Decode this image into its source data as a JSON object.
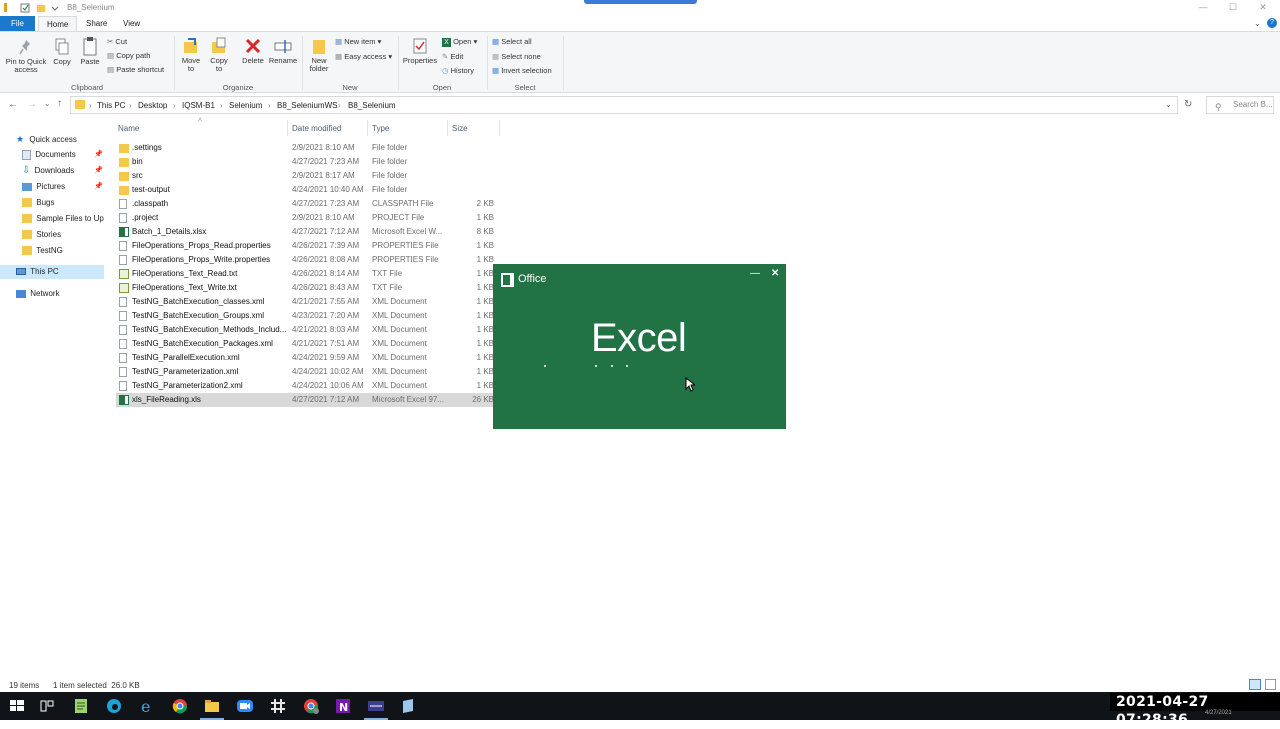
{
  "window": {
    "title": "B8_Selenium",
    "controls": {
      "minimize": "—",
      "maximize": "☐",
      "close": "✕"
    }
  },
  "tabs": [
    "File",
    "Home",
    "Share",
    "View"
  ],
  "ribbon": {
    "clipboard": {
      "pin": "Pin to Quick access",
      "copy": "Copy",
      "paste": "Paste",
      "cut": "Cut",
      "copy_path": "Copy path",
      "paste_shortcut": "Paste shortcut",
      "label": "Clipboard"
    },
    "organize": {
      "move_to": "Move to",
      "copy_to": "Copy to",
      "delete": "Delete",
      "rename": "Rename",
      "label": "Organize"
    },
    "new": {
      "new_folder": "New folder",
      "new_item": "New item",
      "easy_access": "Easy access",
      "label": "New"
    },
    "open": {
      "properties": "Properties",
      "open": "Open",
      "edit": "Edit",
      "history": "History",
      "label": "Open"
    },
    "select": {
      "select_all": "Select all",
      "select_none": "Select none",
      "invert": "Invert selection",
      "label": "Select"
    }
  },
  "breadcrumb": [
    "This PC",
    "Desktop",
    "IQSM-B1",
    "Selenium",
    "B8_SeleniumWS",
    "B8_Selenium"
  ],
  "search": {
    "placeholder": "Search B..."
  },
  "nav": {
    "quick_access": "Quick access",
    "items": [
      "Documents",
      "Downloads",
      "Pictures",
      "Bugs",
      "Sample Files to Uplo",
      "Stories",
      "TestNG"
    ],
    "this_pc": "This PC",
    "network": "Network"
  },
  "columns": {
    "name": "Name",
    "date": "Date modified",
    "type": "Type",
    "size": "Size"
  },
  "files": [
    {
      "name": ".settings",
      "date": "2/9/2021 8:10 AM",
      "type": "File folder",
      "size": "",
      "kind": "folder"
    },
    {
      "name": "bin",
      "date": "4/27/2021 7:23 AM",
      "type": "File folder",
      "size": "",
      "kind": "folder"
    },
    {
      "name": "src",
      "date": "2/9/2021 8:17 AM",
      "type": "File folder",
      "size": "",
      "kind": "folder"
    },
    {
      "name": "test-output",
      "date": "4/24/2021 10:40 AM",
      "type": "File folder",
      "size": "",
      "kind": "folder"
    },
    {
      "name": ".classpath",
      "date": "4/27/2021 7:23 AM",
      "type": "CLASSPATH File",
      "size": "2 KB",
      "kind": "file"
    },
    {
      "name": ".project",
      "date": "2/9/2021 8:10 AM",
      "type": "PROJECT File",
      "size": "1 KB",
      "kind": "file"
    },
    {
      "name": "Batch_1_Details.xlsx",
      "date": "4/27/2021 7:12 AM",
      "type": "Microsoft Excel W...",
      "size": "8 KB",
      "kind": "excel"
    },
    {
      "name": "FileOperations_Props_Read.properties",
      "date": "4/26/2021 7:39 AM",
      "type": "PROPERTIES File",
      "size": "1 KB",
      "kind": "file"
    },
    {
      "name": "FileOperations_Props_Write.properties",
      "date": "4/26/2021 8:08 AM",
      "type": "PROPERTIES File",
      "size": "1 KB",
      "kind": "file"
    },
    {
      "name": "FileOperations_Text_Read.txt",
      "date": "4/26/2021 8:14 AM",
      "type": "TXT File",
      "size": "1 KB",
      "kind": "txt"
    },
    {
      "name": "FileOperations_Text_Write.txt",
      "date": "4/26/2021 8:43 AM",
      "type": "TXT File",
      "size": "1 KB",
      "kind": "txt"
    },
    {
      "name": "TestNG_BatchExecution_classes.xml",
      "date": "4/21/2021 7:55 AM",
      "type": "XML Document",
      "size": "1 KB",
      "kind": "file"
    },
    {
      "name": "TestNG_BatchExecution_Groups.xml",
      "date": "4/23/2021 7:20 AM",
      "type": "XML Document",
      "size": "1 KB",
      "kind": "file"
    },
    {
      "name": "TestNG_BatchExecution_Methods_Includ...",
      "date": "4/21/2021 8:03 AM",
      "type": "XML Document",
      "size": "1 KB",
      "kind": "file"
    },
    {
      "name": "TestNG_BatchExecution_Packages.xml",
      "date": "4/21/2021 7:51 AM",
      "type": "XML Document",
      "size": "1 KB",
      "kind": "file"
    },
    {
      "name": "TestNG_ParallelExecution.xml",
      "date": "4/24/2021 9:59 AM",
      "type": "XML Document",
      "size": "1 KB",
      "kind": "file"
    },
    {
      "name": "TestNG_Parameterization.xml",
      "date": "4/24/2021 10:02 AM",
      "type": "XML Document",
      "size": "1 KB",
      "kind": "file"
    },
    {
      "name": "TestNG_Parameterization2.xml",
      "date": "4/24/2021 10:06 AM",
      "type": "XML Document",
      "size": "1 KB",
      "kind": "file"
    },
    {
      "name": "xls_FileReading.xls",
      "date": "4/27/2021 7:12 AM",
      "type": "Microsoft Excel 97...",
      "size": "26 KB",
      "kind": "excel",
      "selected": true
    }
  ],
  "splash": {
    "brand": "Office",
    "app": "Excel",
    "minimize": "—",
    "close": "✕"
  },
  "status": {
    "count": "19 items",
    "selection": "1 item selected  26.0 KB"
  },
  "clock": {
    "datetime": "2021-04-27 07:28:36",
    "date_small": "4/27/2021"
  },
  "colors": {
    "excel_green": "#217346",
    "file_tab": "#1979ca",
    "folder": "#f4c94b",
    "taskbar": "#101418"
  },
  "taskbar_icons": [
    "start-icon",
    "task-view-icon",
    "notepadpp-icon",
    "edge-icon",
    "ie-icon",
    "file-explorer-icon",
    "zoom-icon",
    "slack-icon",
    "chrome-icon",
    "onenote-icon",
    "terminal-icon",
    "notes-icon"
  ]
}
